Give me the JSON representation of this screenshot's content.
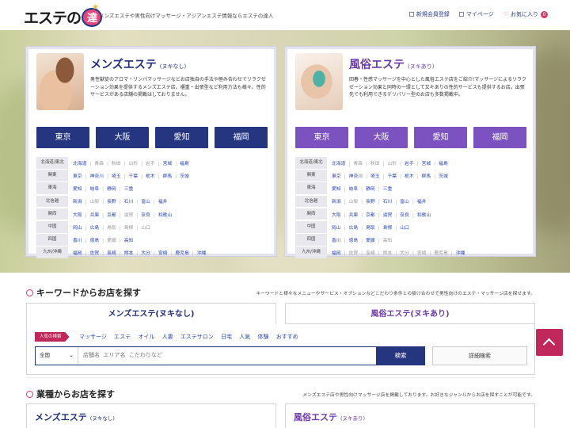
{
  "header": {
    "logo_text": "エステの",
    "logo_circle": "達人",
    "tagline": "メンズエステや男性向けマッサージ・アジアンエステ情報ならエステの達人",
    "links": {
      "register": "新規会員登録",
      "mypage": "マイページ",
      "favorites": "お気に入り",
      "favorites_count": "0"
    }
  },
  "cards": [
    {
      "title": "メンズエステ",
      "subtitle": "(ヌキなし)",
      "description": "男性獣徒のアロマ・リンパマッサージなどお店独自の手法や極み合わせでリラクゼーション効果を提供するメンズエステ店。櫃重・出張型など利用方法も様々。性的サービスがある店舗の掲載はしておりません。",
      "cities": [
        "東京",
        "大阪",
        "愛知",
        "福岡"
      ],
      "regions": [
        {
          "label": "北海道/東北",
          "prefs": [
            {
              "n": "北海道",
              "on": true
            },
            {
              "n": "青森",
              "on": false
            },
            {
              "n": "秋田",
              "on": false
            },
            {
              "n": "山形",
              "on": false
            },
            {
              "n": "岩手",
              "on": false
            },
            {
              "n": "宮城",
              "on": true
            },
            {
              "n": "福島",
              "on": true
            }
          ]
        },
        {
          "label": "関東",
          "prefs": [
            {
              "n": "東京",
              "on": true
            },
            {
              "n": "神奈川",
              "on": true
            },
            {
              "n": "埼玉",
              "on": true
            },
            {
              "n": "千葉",
              "on": true
            },
            {
              "n": "栃木",
              "on": true
            },
            {
              "n": "群馬",
              "on": true
            },
            {
              "n": "茨城",
              "on": true
            }
          ]
        },
        {
          "label": "東海",
          "prefs": [
            {
              "n": "愛知",
              "on": true
            },
            {
              "n": "岐阜",
              "on": true
            },
            {
              "n": "静岡",
              "on": true
            },
            {
              "n": "三重",
              "on": true
            }
          ]
        },
        {
          "label": "北信越",
          "prefs": [
            {
              "n": "新潟",
              "on": true
            },
            {
              "n": "山梨",
              "on": false
            },
            {
              "n": "長野",
              "on": true
            },
            {
              "n": "石川",
              "on": true
            },
            {
              "n": "富山",
              "on": true
            },
            {
              "n": "福井",
              "on": true
            }
          ]
        },
        {
          "label": "関西",
          "prefs": [
            {
              "n": "大阪",
              "on": true
            },
            {
              "n": "兵庫",
              "on": true
            },
            {
              "n": "京都",
              "on": true
            },
            {
              "n": "滋賀",
              "on": false
            },
            {
              "n": "奈良",
              "on": true
            },
            {
              "n": "和歌山",
              "on": true
            }
          ]
        },
        {
          "label": "中国",
          "prefs": [
            {
              "n": "岡山",
              "on": true
            },
            {
              "n": "広島",
              "on": true
            },
            {
              "n": "鳥取",
              "on": false
            },
            {
              "n": "島根",
              "on": false
            },
            {
              "n": "山口",
              "on": false
            }
          ]
        },
        {
          "label": "四国",
          "prefs": [
            {
              "n": "香川",
              "on": true
            },
            {
              "n": "徳島",
              "on": true
            },
            {
              "n": "愛媛",
              "on": false
            },
            {
              "n": "高知",
              "on": true
            }
          ]
        },
        {
          "label": "九州/沖縄",
          "prefs": [
            {
              "n": "福岡",
              "on": true
            },
            {
              "n": "佐賀",
              "on": true
            },
            {
              "n": "長崎",
              "on": true
            },
            {
              "n": "熊本",
              "on": true
            },
            {
              "n": "大分",
              "on": true
            },
            {
              "n": "宮崎",
              "on": true
            },
            {
              "n": "鹿児島",
              "on": true
            },
            {
              "n": "沖縄",
              "on": true
            }
          ]
        }
      ]
    },
    {
      "title": "風俗エステ",
      "subtitle": "(ヌキあり)",
      "description": "回春・性感マッサージを中心とした風俗エステ店をご紹介!マッサージによるリラクゼーション効果と同時の一環として又キありの性的サービスも提供するお店。出張先でも利用できるデリバリー型のお店も多数掲載中。",
      "cities": [
        "東京",
        "大阪",
        "愛知",
        "福岡"
      ],
      "regions": [
        {
          "label": "北海道/東北",
          "prefs": [
            {
              "n": "北海道",
              "on": true
            },
            {
              "n": "青森",
              "on": false
            },
            {
              "n": "秋田",
              "on": false
            },
            {
              "n": "山形",
              "on": false
            },
            {
              "n": "岩手",
              "on": true
            },
            {
              "n": "宮城",
              "on": true
            },
            {
              "n": "福島",
              "on": true
            }
          ]
        },
        {
          "label": "関東",
          "prefs": [
            {
              "n": "東京",
              "on": true
            },
            {
              "n": "神奈川",
              "on": true
            },
            {
              "n": "埼玉",
              "on": true
            },
            {
              "n": "千葉",
              "on": true
            },
            {
              "n": "栃木",
              "on": true
            },
            {
              "n": "群馬",
              "on": true
            },
            {
              "n": "茨城",
              "on": true
            }
          ]
        },
        {
          "label": "東海",
          "prefs": [
            {
              "n": "愛知",
              "on": true
            },
            {
              "n": "岐阜",
              "on": true
            },
            {
              "n": "静岡",
              "on": true
            },
            {
              "n": "三重",
              "on": true
            }
          ]
        },
        {
          "label": "北信越",
          "prefs": [
            {
              "n": "新潟",
              "on": true
            },
            {
              "n": "山梨",
              "on": false
            },
            {
              "n": "長野",
              "on": true
            },
            {
              "n": "石川",
              "on": true
            },
            {
              "n": "富山",
              "on": true
            },
            {
              "n": "福井",
              "on": true
            }
          ]
        },
        {
          "label": "関西",
          "prefs": [
            {
              "n": "大阪",
              "on": true
            },
            {
              "n": "兵庫",
              "on": true
            },
            {
              "n": "京都",
              "on": true
            },
            {
              "n": "滋賀",
              "on": true
            },
            {
              "n": "奈良",
              "on": true
            },
            {
              "n": "和歌山",
              "on": true
            }
          ]
        },
        {
          "label": "中国",
          "prefs": [
            {
              "n": "岡山",
              "on": true
            },
            {
              "n": "広島",
              "on": true
            },
            {
              "n": "鳥取",
              "on": true
            },
            {
              "n": "島根",
              "on": true
            },
            {
              "n": "山口",
              "on": true
            }
          ]
        },
        {
          "label": "四国",
          "prefs": [
            {
              "n": "香川",
              "on": true
            },
            {
              "n": "徳島",
              "on": true
            },
            {
              "n": "愛媛",
              "on": true
            },
            {
              "n": "高知",
              "on": false
            }
          ]
        },
        {
          "label": "九州/沖縄",
          "prefs": [
            {
              "n": "福岡",
              "on": true
            },
            {
              "n": "佐賀",
              "on": false
            },
            {
              "n": "長崎",
              "on": false
            },
            {
              "n": "熊本",
              "on": false
            },
            {
              "n": "大分",
              "on": false
            },
            {
              "n": "宮崎",
              "on": false
            },
            {
              "n": "鹿児島",
              "on": false
            },
            {
              "n": "沖縄",
              "on": true
            }
          ]
        }
      ]
    }
  ],
  "keyword_section": {
    "title": "キーワードからお店を探す",
    "note": "キーワードと様々なメニューやサービス・オプションなどこだわり条件との掛け合わせで男性向けのエステ・マッサージ店を探せます。",
    "tabs": [
      "メンズエステ(ヌキなし)",
      "風俗エステ(ヌキあり)"
    ],
    "popular_label": "人気の検索",
    "popular_words": [
      "マッサージ",
      "エステ",
      "オイル",
      "人妻",
      "エステサロン",
      "日宅",
      "人気",
      "体験",
      "おすすめ"
    ],
    "area_value": "全国",
    "input_placeholder": "店舗名  エリア名  こだわりなど",
    "search_button": "検索",
    "detail_button": "詳細検索"
  },
  "genre_section": {
    "title": "業種からお店を探す",
    "note": "メンズエステ店や男性向けマッサージ店を掲載しております。お好きなジャンルからお店を探すことが可能です。",
    "cards": [
      {
        "title": "メンズエステ",
        "subtitle": "(ヌキなし)"
      },
      {
        "title": "風俗エステ",
        "subtitle": "(ヌキあり)"
      }
    ]
  },
  "colors": {
    "navy": "#26357f",
    "purple": "#7c52c0",
    "accent_pink": "#c0275a",
    "link_blue": "#2a46b5"
  }
}
